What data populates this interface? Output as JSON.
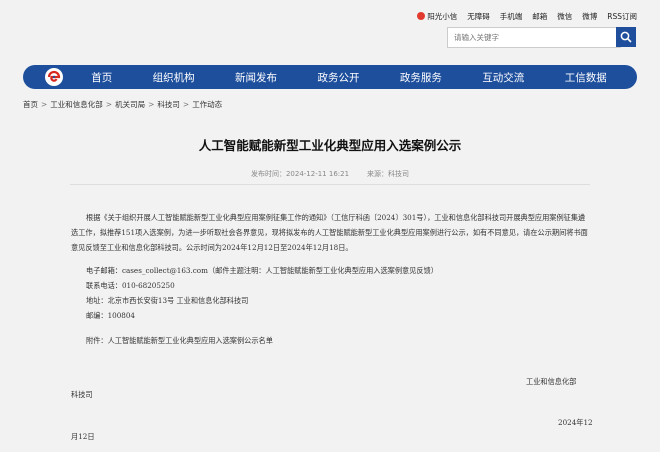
{
  "header": {
    "links": [
      "阳光小信",
      "无障碍",
      "手机端",
      "邮箱",
      "微信",
      "微博",
      "RSS订阅"
    ],
    "search_placeholder": "请输入关键字"
  },
  "nav": {
    "items": [
      "首页",
      "组织机构",
      "新闻发布",
      "政务公开",
      "政务服务",
      "互动交流",
      "工信数据"
    ]
  },
  "breadcrumb": [
    "首页",
    "工业和信息化部",
    "机关司局",
    "科技司",
    "工作动态"
  ],
  "article": {
    "title": "人工智能赋能新型工业化典型应用入选案例公示",
    "date_label": "发布时间：",
    "date": "2024-12-11 16:21",
    "source_label": "来源：",
    "source": "科技司",
    "paragraph": "根据《关于组织开展人工智能赋能新型工业化典型应用案例征集工作的通知》（工信厅科函〔2024〕301号），工业和信息化部科技司开展典型应用案例征集遴选工作，拟推荐151项入选案例，为进一步听取社会各界意见，现将拟发布的人工智能赋能新型工业化典型应用案例进行公示，如有不同意见，请在公示期间将书面意见反馈至工业和信息化部科技司。公示时间为2024年12月12日至2024年12月18日。",
    "email": "电子邮箱：cases_collect@163.com（邮件主题注明：人工智能赋能新型工业化典型应用入选案例意见反馈）",
    "phone": "联系电话：010-68205250",
    "address": "地址：北京市西长安街13号 工业和信息化部科技司",
    "postcode": "邮编：100804",
    "attachment": "附件：人工智能赋能新型工业化典型应用入选案例公示名单",
    "signature_1": "工业和信息化部",
    "signature_2": "科技司",
    "date_1": "2024年12",
    "date_2": "月12日"
  }
}
